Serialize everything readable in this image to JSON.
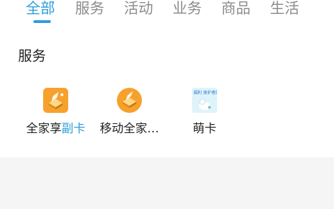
{
  "tabs": [
    {
      "label": "全部",
      "active": true
    },
    {
      "label": "服务",
      "active": false
    },
    {
      "label": "活动",
      "active": false
    },
    {
      "label": "业务",
      "active": false
    },
    {
      "label": "商品",
      "active": false
    },
    {
      "label": "生活",
      "active": false
    }
  ],
  "section": {
    "title": "服务"
  },
  "items": [
    {
      "label_main": "全家享",
      "label_accent": "副卡",
      "icon": "family-card-icon"
    },
    {
      "label": "移动全家…",
      "icon": "mobile-family-icon"
    },
    {
      "label": "萌卡",
      "icon": "cute-card-icon",
      "icon_text": "福利 保护者的搭子"
    }
  ],
  "colors": {
    "accent": "#2e9cdc",
    "icon_orange": "#f7a12d",
    "muted": "#8c8c8c"
  }
}
